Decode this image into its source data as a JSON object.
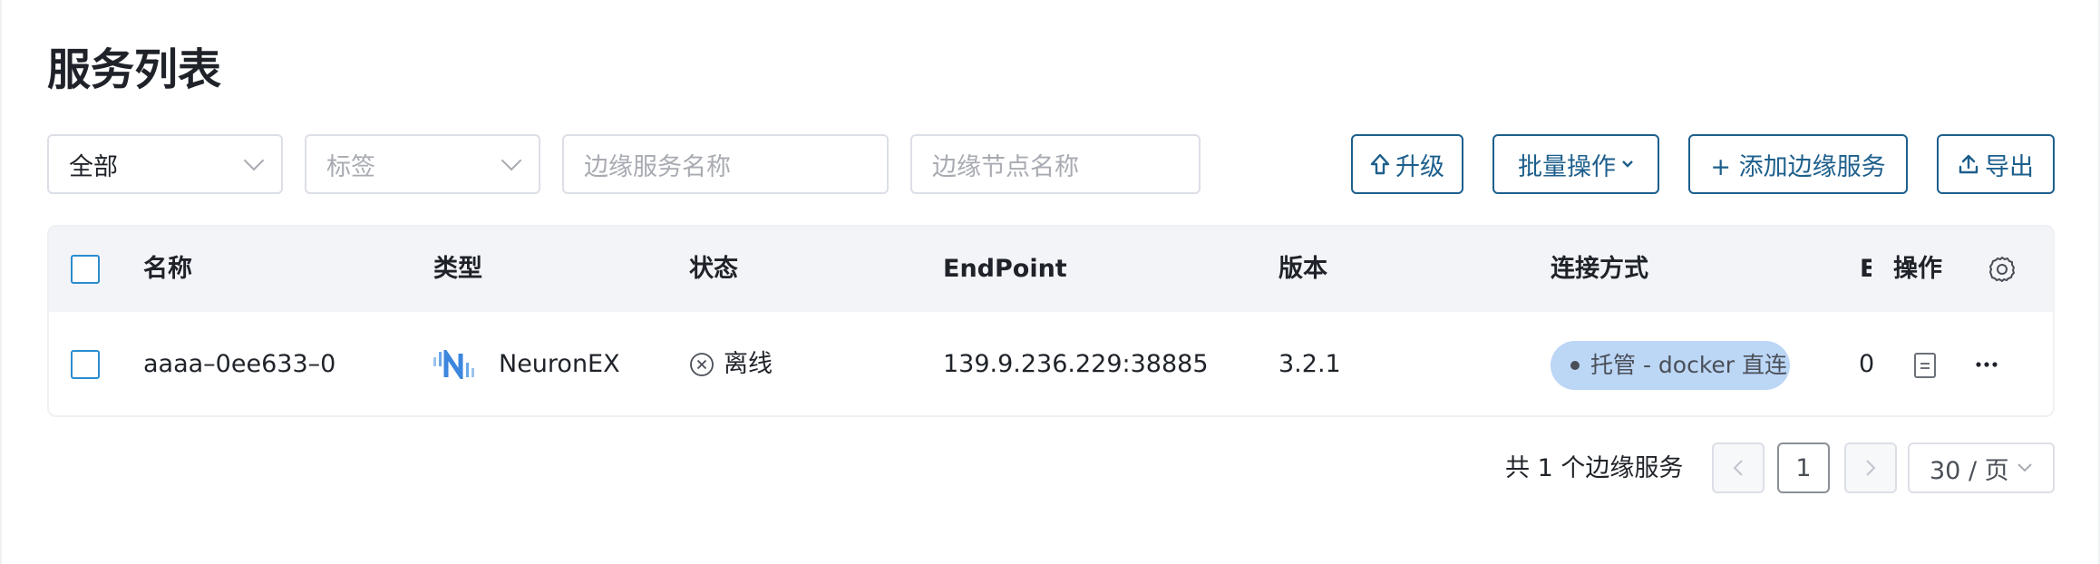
{
  "page": {
    "title": "服务列表"
  },
  "filters": {
    "status_select": {
      "value": "全部"
    },
    "tag_select": {
      "placeholder": "标签"
    },
    "service_name_input": {
      "placeholder": "边缘服务名称"
    },
    "node_name_input": {
      "placeholder": "边缘节点名称"
    }
  },
  "actions": {
    "upgrade_label": "升级",
    "batch_label": "批量操作",
    "add_label": "+ 添加边缘服务",
    "export_label": "导出"
  },
  "table": {
    "columns": [
      "名称",
      "类型",
      "状态",
      "EndPoint",
      "版本",
      "连接方式",
      "E",
      "操作"
    ],
    "rows": [
      {
        "name": "aaaa–0ee633–0",
        "type": "NeuronEX",
        "status": "离线",
        "endpoint": "139.9.236.229:38885",
        "version": "3.2.1",
        "connection": "托管 - docker 直连",
        "extra": "0"
      }
    ]
  },
  "pagination": {
    "total_text": "共 1 个边缘服务",
    "current_page": "1",
    "page_size": "30 / 页"
  },
  "colors": {
    "primary": "#1d5f8c",
    "checkbox": "#2a8ccf",
    "badge_bg": "#bcd6f6",
    "header_bg": "#f2f4f8",
    "brand_icon": "#4a90e2"
  },
  "icons": {
    "upgrade": "arrow-up-outline-icon",
    "batch": "chevron-down-icon",
    "export": "upload-icon",
    "settings": "gear-icon",
    "type": "neuronex-logo-icon",
    "status": "circle-x-icon",
    "detail": "document-icon",
    "more": "ellipsis-icon"
  }
}
